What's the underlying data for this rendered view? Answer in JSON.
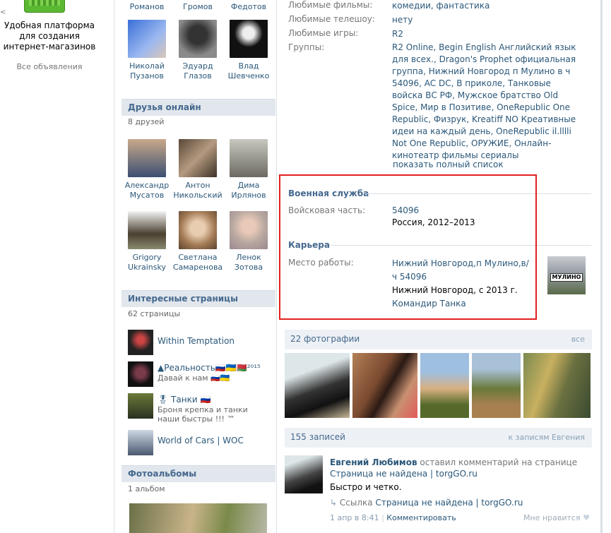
{
  "ad": {
    "mark": "<",
    "title": "Удобная платформа для создания интернет-магазинов",
    "all_ads": "Все объявления"
  },
  "friends_top": [
    {
      "name": "Романов"
    },
    {
      "name": "Громов"
    },
    {
      "name": "Федотов"
    },
    {
      "name": "Николай Пузанов"
    },
    {
      "name": "Эдуард Глазов"
    },
    {
      "name": "Влад Шевченко"
    }
  ],
  "friends_online": {
    "title": "Друзья онлайн",
    "count": "8 друзей",
    "items": [
      {
        "name": "Александр Мусатов"
      },
      {
        "name": "Антон Никольский"
      },
      {
        "name": "Дима Ирлянов"
      },
      {
        "name": "Grigory Ukrainsky"
      },
      {
        "name": "Светлана Самаренова"
      },
      {
        "name": "Ленок Зотова"
      }
    ]
  },
  "interesting_pages": {
    "title": "Интересные страницы",
    "count": "62 страницы",
    "items": [
      {
        "title": "Within Temptation",
        "desc": ""
      },
      {
        "title": "▲Реальность🇷🇺🇺🇦🇧🇾²⁰¹⁵",
        "desc": "Давай к нам 🇷🇺🇺🇦"
      },
      {
        "title": "🎖 Танки 🇷🇺",
        "desc": "Броня крепка и танки наши быстры !!! ™"
      },
      {
        "title": "World of Cars | WOC",
        "desc": ""
      }
    ]
  },
  "albums": {
    "title": "Фотоальбомы",
    "count": "1 альбом"
  },
  "info": {
    "rows": [
      {
        "label": "Любимые фильмы:",
        "value": "комедии, фантастика"
      },
      {
        "label": "Любимые телешоу:",
        "value": "нету"
      },
      {
        "label": "Любимые игры:",
        "value": "R2"
      },
      {
        "label": "Группы:",
        "value": "R2 Online, Begin English Английский язык для всех., Dragon's Prophet официальная группа, Нижний Новгород п Мулино в ч 54096, AC DC, В приколе, Танковые войска ВС РФ, Мужское братство Old Spice, Мир в Позитиве, OneRepublic One Republic, Физрук, Kreatiff NO Креативные идеи на каждый день, OneRepublic il.lllli Not One Republic, ОРУЖИЕ, Онлайн-кинотеатр фильмы сериалы"
      }
    ],
    "show_all": "показать полный список"
  },
  "military": {
    "title": "Военная служба",
    "label": "Войсковая часть:",
    "unit": "54096",
    "place": "Россия, 2012–2013"
  },
  "career": {
    "title": "Карьера",
    "label": "Место работы:",
    "place": "Нижний Новгород,п Мулино,в/ч 54096",
    "city": "Нижний Новгород, с 2013 г.",
    "position": "Командир Танка",
    "thumb_text": "МУЛИНО"
  },
  "photos": {
    "title": "22 фотографии",
    "all": "все"
  },
  "wall": {
    "title": "155 записей",
    "to_posts": "к записям Евгения",
    "author": "Евгений Любимов",
    "action": "оставил комментарий на странице",
    "page_link": "Страница не найдена | torgGO.ru",
    "text": "Быстро и четко.",
    "link_prefix": "Ссылка",
    "link": "Страница не найдена | torgGO.ru",
    "date": "1 апр в 8:41",
    "comment": "Комментировать",
    "like": "Мне нравится"
  },
  "colors": {
    "link": "#2B587A",
    "header_bg": "#e1e7ed",
    "highlight": "#e02020"
  }
}
